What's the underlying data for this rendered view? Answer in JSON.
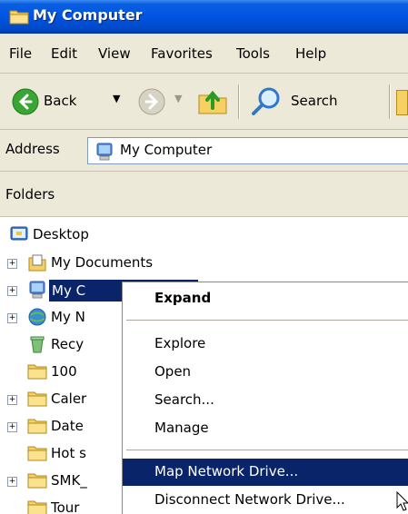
{
  "window": {
    "title": "My Computer",
    "title_icon": "folder-icon",
    "colors": {
      "titlebar": "#0054e3",
      "chrome": "#ece9d8",
      "selection": "#0a246a"
    }
  },
  "menu": {
    "items": [
      "File",
      "Edit",
      "View",
      "Favorites",
      "Tools",
      "Help"
    ]
  },
  "toolbar": {
    "back_label": "Back",
    "search_label": "Search"
  },
  "address": {
    "label": "Address",
    "value": "My Computer"
  },
  "folders": {
    "title": "Folders",
    "tree": [
      {
        "label": "Desktop",
        "icon": "desktop-icon"
      },
      {
        "label": "My Documents",
        "icon": "my-documents-icon",
        "expander": "+"
      },
      {
        "label": "My C",
        "icon": "my-computer-icon",
        "expander": "+",
        "selected": true
      },
      {
        "label": "My N",
        "icon": "my-network-icon",
        "expander": "+"
      },
      {
        "label": "Recy",
        "icon": "recycle-bin-icon"
      },
      {
        "label": "100",
        "icon": "folder-icon"
      },
      {
        "label": "Caler",
        "icon": "folder-icon",
        "expander": "+"
      },
      {
        "label": "Date",
        "icon": "folder-icon",
        "expander": "+"
      },
      {
        "label": "Hot s",
        "icon": "folder-icon"
      },
      {
        "label": "SMK_",
        "icon": "folder-icon",
        "expander": "+"
      },
      {
        "label": "Tour",
        "icon": "folder-icon"
      }
    ]
  },
  "context_menu": {
    "items": [
      {
        "label": "Expand",
        "bold": true
      },
      {
        "label": "Explore"
      },
      {
        "label": "Open"
      },
      {
        "label": "Search..."
      },
      {
        "label": "Manage"
      },
      {
        "label": "Map Network Drive...",
        "highlighted": true
      },
      {
        "label": "Disconnect Network Drive..."
      }
    ]
  }
}
